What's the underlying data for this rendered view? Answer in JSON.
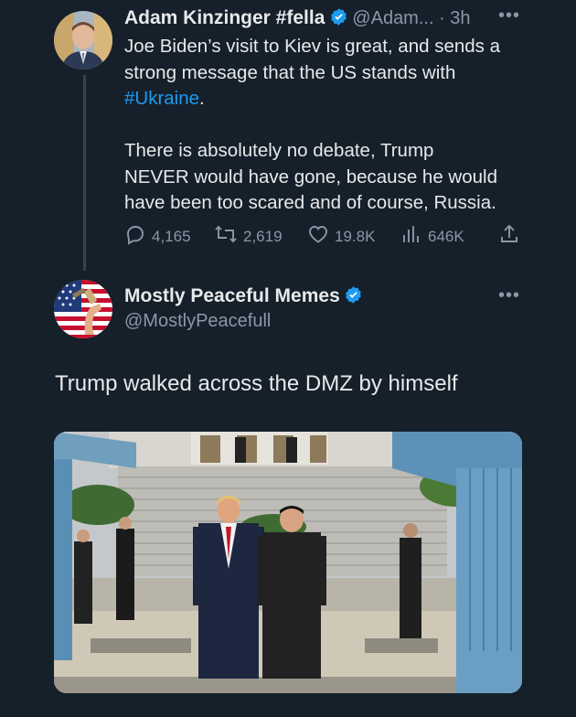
{
  "tweet1": {
    "author_name": "Adam Kinzinger #fella",
    "author_handle": "@Adam...",
    "time": "3h",
    "text_line1": "Joe Biden’s visit to Kiev is great, and sends a",
    "text_line2": "strong message that the US stands with",
    "hashtag": "#Ukraine",
    "hashtag_suffix": ".",
    "text2_line1": "There is absolutely no debate, Trump",
    "text2_line2": "NEVER would have gone, because he would",
    "text2_line3": "have been too scared and of course, Russia.",
    "replies": "4,165",
    "retweets": "2,619",
    "likes": "19.8K",
    "views": "646K"
  },
  "tweet2": {
    "author_name": "Mostly Peaceful Memes",
    "author_handle": "@MostlyPeacefull",
    "text": "Trump walked across the DMZ by himself"
  },
  "icons": {
    "verified": "verified-badge-icon",
    "more": "more-dots-icon",
    "reply": "reply-icon",
    "retweet": "retweet-icon",
    "like": "heart-icon",
    "views": "views-icon",
    "share": "share-icon"
  },
  "colors": {
    "background": "#15202b",
    "text": "#e7e9ea",
    "muted": "#8b98a5",
    "accent": "#1d9bf0"
  }
}
